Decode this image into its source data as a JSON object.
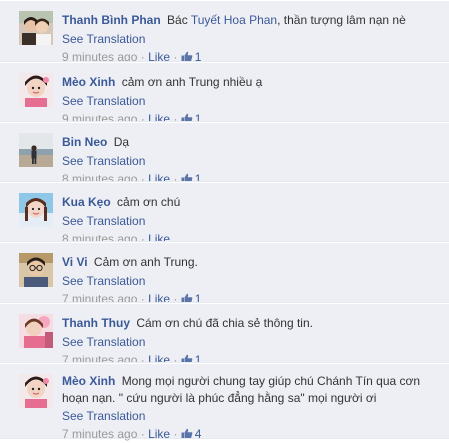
{
  "separator": "·",
  "comments": [
    {
      "author": "Thanh Bình Phan",
      "text_before": "Bác",
      "mention": "Tuyết Hoa Phan",
      "text_after": ", thần tượng lâm nạn nè",
      "translation_link": "See Translation",
      "time": "9 minutes ago",
      "like_label": "Like",
      "likes": "1",
      "avatar_icon": "avatar-photo-couple"
    },
    {
      "author": "Mèo Xinh",
      "text": "cảm ơn anh Trung nhiều ạ",
      "translation_link": "See Translation",
      "time": "9 minutes ago",
      "like_label": "Like",
      "likes": "1",
      "avatar_icon": "avatar-photo-girl"
    },
    {
      "author": "Bin Neo",
      "text": "Dạ",
      "translation_link": "See Translation",
      "time": "8 minutes ago",
      "like_label": "Like",
      "likes": "1",
      "avatar_icon": "avatar-photo-beach"
    },
    {
      "author": "Kua Kẹo",
      "text": "cảm ơn chú",
      "translation_link": "See Translation",
      "time": "8 minutes ago",
      "like_label": "Like",
      "likes": "",
      "avatar_icon": "avatar-photo-girl-blue"
    },
    {
      "author": "Vi Vi",
      "text": "Cảm ơn anh Trung.",
      "translation_link": "See Translation",
      "time": "7 minutes ago",
      "like_label": "Like",
      "likes": "1",
      "avatar_icon": "avatar-photo-man-glasses"
    },
    {
      "author": "Thanh Thuy",
      "text": "Cám ơn chú đã chia sẻ thông tin.",
      "translation_link": "See Translation",
      "time": "7 minutes ago",
      "like_label": "Like",
      "likes": "1",
      "avatar_icon": "avatar-photo-woman-pink"
    },
    {
      "author": "Mèo Xinh",
      "text": "Mong mọi người chung tay giúp chú Chánh Tín qua cơn hoạn nạn. \" cứu người là phúc đẳng hằng sa\" mọi người ơi",
      "translation_link": "See Translation",
      "time": "7 minutes ago",
      "like_label": "Like",
      "likes": "4",
      "avatar_icon": "avatar-photo-girl"
    }
  ]
}
